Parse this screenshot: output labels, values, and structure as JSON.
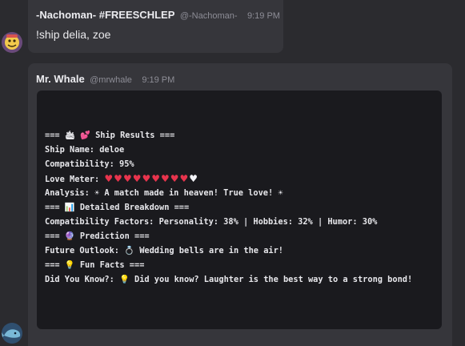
{
  "messages": [
    {
      "author": "-Nachoman- #FREESCHLEP",
      "handle": "@-Nachoman-",
      "time": "9:19 PM",
      "text": "!ship delia, zoe"
    },
    {
      "author": "Mr. Whale",
      "handle": "@mrwhale",
      "time": "9:19 PM"
    }
  ],
  "ship_result": {
    "header_results": "=== 🛳 💕 Ship Results ===",
    "ship_name": "Ship Name: deloe",
    "compatibility": "Compatibility: 95%",
    "love_meter_label": "Love Meter: ",
    "love_meter": {
      "filled": 9,
      "total": 10
    },
    "analysis": "Analysis: ☀ A match made in heaven! True love! ☀",
    "header_breakdown": "=== 📊 Detailed Breakdown ===",
    "factors": "Compatibility Factors: Personality: 38% | Hobbies: 32% | Humor: 30%",
    "header_prediction": "=== 🔮 Prediction ===",
    "future": "Future Outlook: 💍 Wedding bells are in the air!",
    "header_funfacts": "=== 💡 Fun Facts ===",
    "did_you_know": "Did You Know?: 💡 Did you know? Laughter is the best way to a strong bond!"
  },
  "colors": {
    "background": "#2b2b2f",
    "bubble": "#36363b",
    "codeblock": "#1a1a1e",
    "heart": "#e8344d"
  }
}
